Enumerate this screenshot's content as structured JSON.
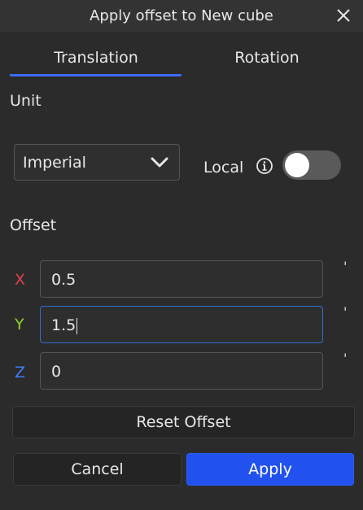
{
  "window": {
    "title": "Apply offset to New cube"
  },
  "tabs": [
    {
      "label": "Translation",
      "active": true
    },
    {
      "label": "Rotation",
      "active": false
    }
  ],
  "unit": {
    "label": "Unit",
    "selected": "Imperial",
    "local_label": "Local",
    "local_enabled": false
  },
  "offset": {
    "label": "Offset",
    "fields": [
      {
        "axis": "X",
        "value": "0.5",
        "color": "#e0414f",
        "unit": "'"
      },
      {
        "axis": "Y",
        "value": "1.5",
        "color": "#8fd32e",
        "unit": "'"
      },
      {
        "axis": "Z",
        "value": "0",
        "color": "#3d7dff",
        "unit": "'"
      }
    ]
  },
  "buttons": {
    "reset": "Reset Offset",
    "cancel": "Cancel",
    "apply": "Apply"
  },
  "colors": {
    "accent": "#3d6bff",
    "apply_button": "#2152f0"
  },
  "icons": [
    "close-icon",
    "chevron-down-icon",
    "info-icon"
  ]
}
